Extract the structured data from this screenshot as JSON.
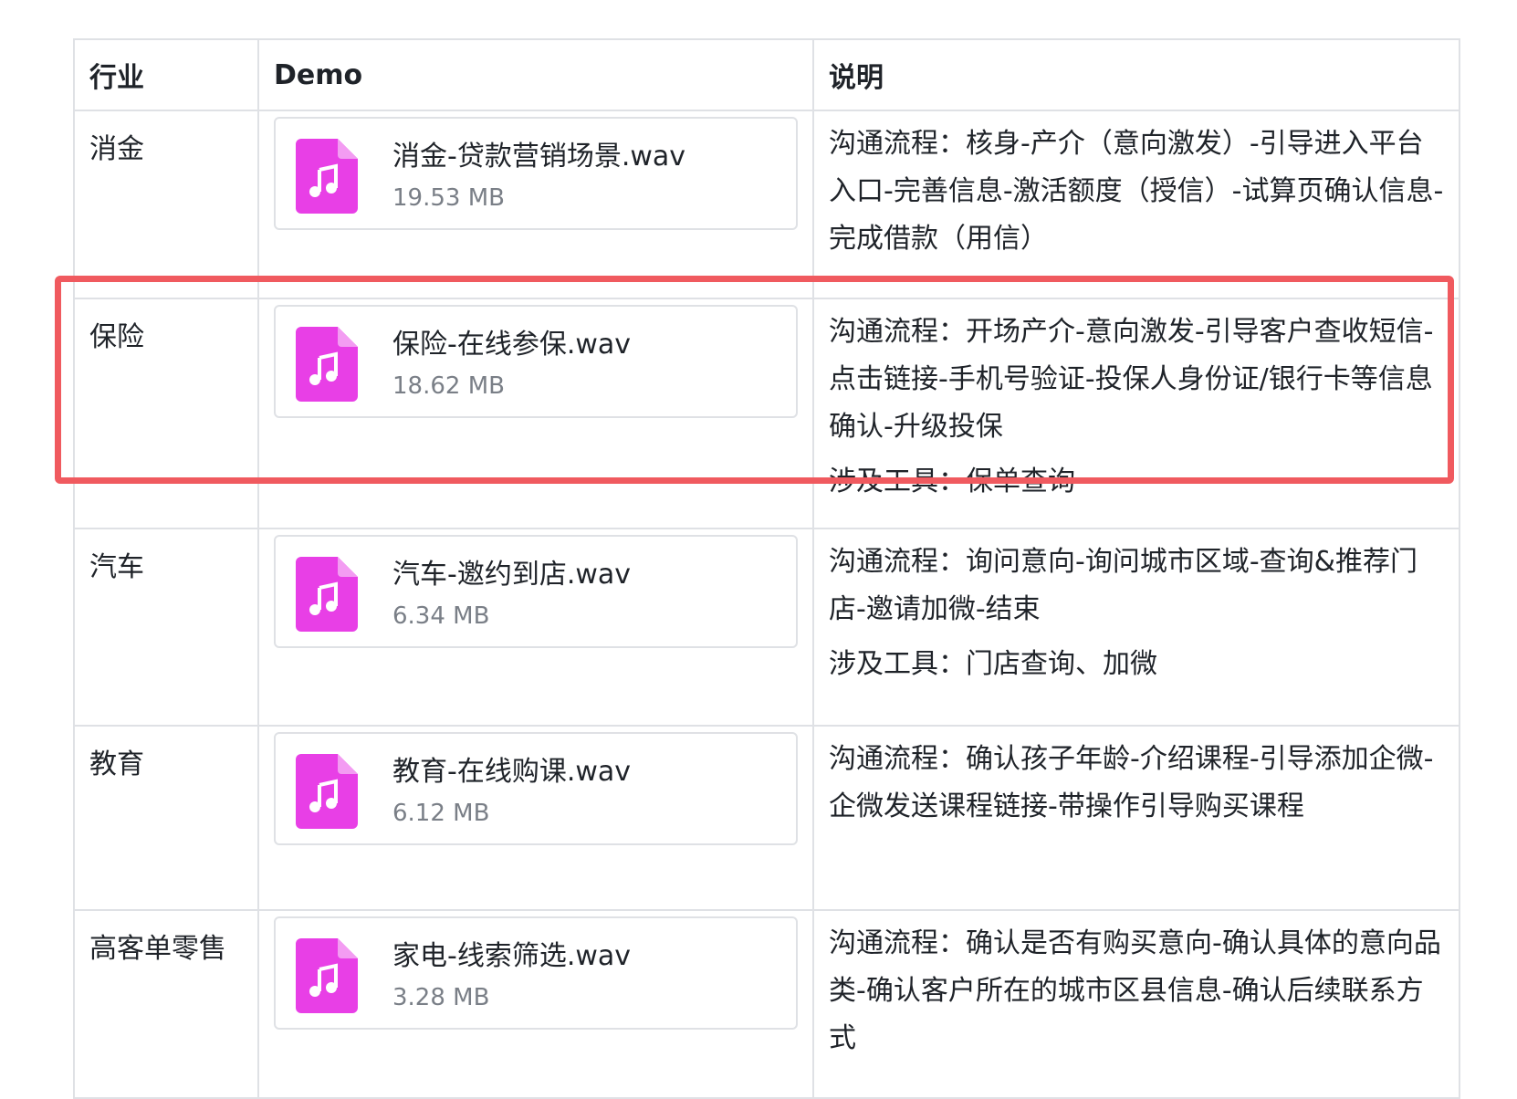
{
  "table": {
    "headers": [
      "行业",
      "Demo",
      "说明"
    ],
    "rows": [
      {
        "industry": "消金",
        "file_name": "消金-贷款营销场景.wav",
        "file_size": "19.53 MB",
        "process": "沟通流程：核身-产介（意向激发）-引导进入平台入口-完善信息-激活额度（授信）-试算页确认信息-完成借款（用信）",
        "tools": ""
      },
      {
        "industry": "保险",
        "file_name": "保险-在线参保.wav",
        "file_size": "18.62 MB",
        "process": "沟通流程：开场产介-意向激发-引导客户查收短信-点击链接-手机号验证-投保人身份证/银行卡等信息确认-升级投保",
        "tools": "涉及工具：保单查询"
      },
      {
        "industry": "汽车",
        "file_name": "汽车-邀约到店.wav",
        "file_size": "6.34 MB",
        "process": "沟通流程：询问意向-询问城市区域-查询&推荐门店-邀请加微-结束",
        "tools": "涉及工具：门店查询、加微"
      },
      {
        "industry": "教育",
        "file_name": "教育-在线购课.wav",
        "file_size": "6.12 MB",
        "process": "沟通流程：确认孩子年龄-介绍课程-引导添加企微-企微发送课程链接-带操作引导购买课程",
        "tools": ""
      },
      {
        "industry": "高客单零售",
        "file_name": "家电-线索筛选.wav",
        "file_size": "3.28 MB",
        "process": "沟通流程：确认是否有购买意向-确认具体的意向品类-确认客户所在的城市区县信息-确认后续联系方式",
        "tools": ""
      }
    ]
  },
  "icons": {
    "file": "music-file-icon"
  },
  "colors": {
    "file_icon": "#e83fe6",
    "highlight": "#f05a5f",
    "border": "#dfe1e5"
  }
}
